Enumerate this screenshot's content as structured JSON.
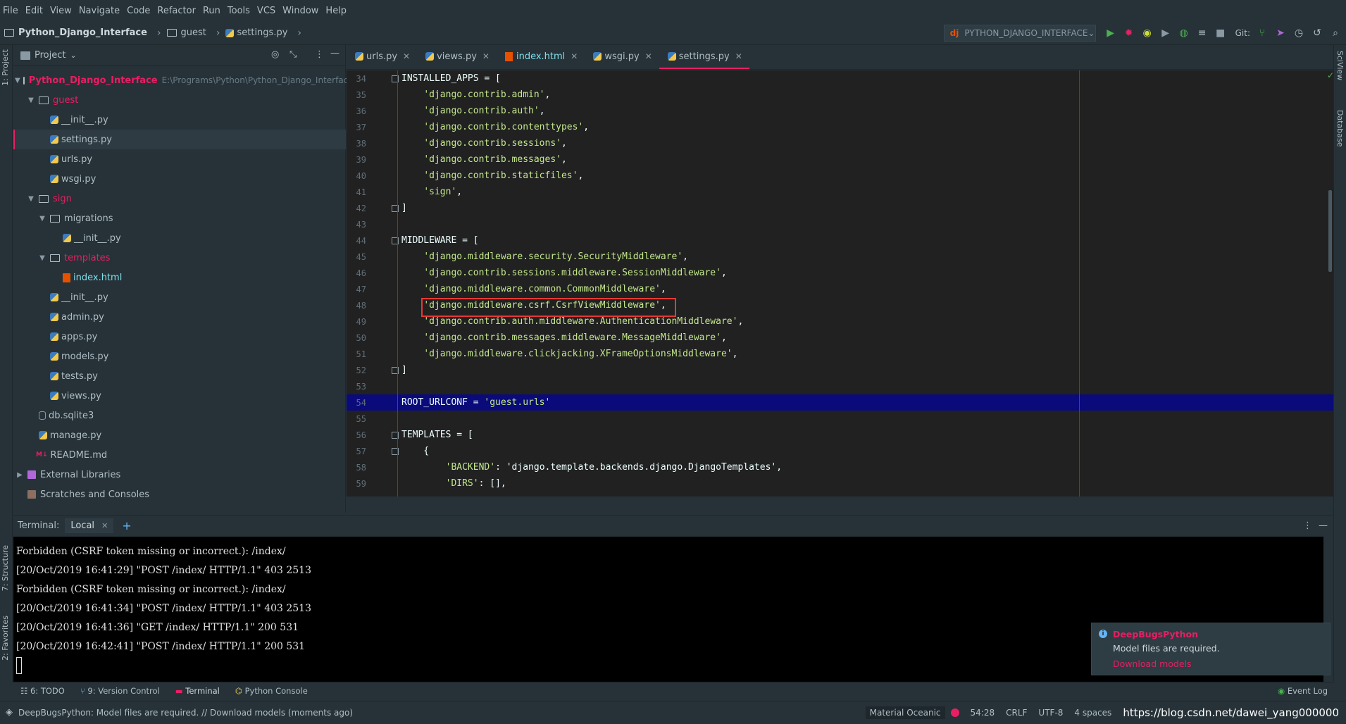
{
  "menu": [
    "File",
    "Edit",
    "View",
    "Navigate",
    "Code",
    "Refactor",
    "Run",
    "Tools",
    "VCS",
    "Window",
    "Help"
  ],
  "breadcrumb": {
    "project": "Python_Django_Interface",
    "folder": "guest",
    "file": "settings.py"
  },
  "run_config": {
    "label": "PYTHON_DJANGO_INTERFACE",
    "git_label": "Git:"
  },
  "project_panel": {
    "title": "Project",
    "tree": [
      {
        "label": "Python_Django_Interface",
        "path": "E:\\Programs\\Python\\Python_Django_Interface"
      },
      {
        "label": "guest"
      },
      {
        "label": "__init__.py"
      },
      {
        "label": "settings.py"
      },
      {
        "label": "urls.py"
      },
      {
        "label": "wsgi.py"
      },
      {
        "label": "sign"
      },
      {
        "label": "migrations"
      },
      {
        "label": "__init__.py"
      },
      {
        "label": "templates"
      },
      {
        "label": "index.html"
      },
      {
        "label": "__init__.py"
      },
      {
        "label": "admin.py"
      },
      {
        "label": "apps.py"
      },
      {
        "label": "models.py"
      },
      {
        "label": "tests.py"
      },
      {
        "label": "views.py"
      },
      {
        "label": "db.sqlite3"
      },
      {
        "label": "manage.py"
      },
      {
        "label": "README.md"
      },
      {
        "label": "External Libraries"
      },
      {
        "label": "Scratches and Consoles"
      }
    ]
  },
  "left_strip": {
    "project": "1: Project",
    "structure": "7: Structure",
    "favorites": "2: Favorites"
  },
  "right_strip": {
    "sciview": "SciView",
    "database": "Database"
  },
  "editor_tabs": [
    {
      "label": "urls.py"
    },
    {
      "label": "views.py"
    },
    {
      "label": "index.html"
    },
    {
      "label": "wsgi.py"
    },
    {
      "label": "settings.py"
    }
  ],
  "code_lines": [
    {
      "n": "34",
      "pre": "INSTALLED_APPS = [",
      "s": "",
      "post": ""
    },
    {
      "n": "35",
      "pre": "    ",
      "s": "'django.contrib.admin'",
      "post": ","
    },
    {
      "n": "36",
      "pre": "    ",
      "s": "'django.contrib.auth'",
      "post": ","
    },
    {
      "n": "37",
      "pre": "    ",
      "s": "'django.contrib.contenttypes'",
      "post": ","
    },
    {
      "n": "38",
      "pre": "    ",
      "s": "'django.contrib.sessions'",
      "post": ","
    },
    {
      "n": "39",
      "pre": "    ",
      "s": "'django.contrib.messages'",
      "post": ","
    },
    {
      "n": "40",
      "pre": "    ",
      "s": "'django.contrib.staticfiles'",
      "post": ","
    },
    {
      "n": "41",
      "pre": "    ",
      "s": "'sign'",
      "post": ","
    },
    {
      "n": "42",
      "pre": "]",
      "s": "",
      "post": ""
    },
    {
      "n": "43",
      "pre": "",
      "s": "",
      "post": ""
    },
    {
      "n": "44",
      "pre": "MIDDLEWARE = [",
      "s": "",
      "post": ""
    },
    {
      "n": "45",
      "pre": "    ",
      "s": "'django.middleware.security.SecurityMiddleware'",
      "post": ","
    },
    {
      "n": "46",
      "pre": "    ",
      "s": "'django.contrib.sessions.middleware.SessionMiddleware'",
      "post": ","
    },
    {
      "n": "47",
      "pre": "    ",
      "s": "'django.middleware.common.CommonMiddleware'",
      "post": ","
    },
    {
      "n": "48",
      "pre": "    ",
      "s": "'django.middleware.csrf.CsrfViewMiddleware'",
      "post": ","
    },
    {
      "n": "49",
      "pre": "    ",
      "s": "'django.contrib.auth.middleware.AuthenticationMiddleware'",
      "post": ","
    },
    {
      "n": "50",
      "pre": "    ",
      "s": "'django.contrib.messages.middleware.MessageMiddleware'",
      "post": ","
    },
    {
      "n": "51",
      "pre": "    ",
      "s": "'django.middleware.clickjacking.XFrameOptionsMiddleware'",
      "post": ","
    },
    {
      "n": "52",
      "pre": "]",
      "s": "",
      "post": ""
    },
    {
      "n": "53",
      "pre": "",
      "s": "",
      "post": ""
    },
    {
      "n": "54",
      "pre": "ROOT_URLCONF = ",
      "s": "'guest.urls'",
      "post": ""
    },
    {
      "n": "55",
      "pre": "",
      "s": "",
      "post": ""
    },
    {
      "n": "56",
      "pre": "TEMPLATES = [",
      "s": "",
      "post": ""
    },
    {
      "n": "57",
      "pre": "    {",
      "s": "",
      "post": ""
    },
    {
      "n": "58",
      "pre": "        ",
      "s": "'BACKEND'",
      "post": ": 'django.template.backends.django.DjangoTemplates',"
    },
    {
      "n": "59",
      "pre": "        ",
      "s": "'DIRS'",
      "post": ": [],"
    }
  ],
  "terminal": {
    "label": "Terminal:",
    "tab": "Local",
    "lines": [
      "Forbidden (CSRF token missing or incorrect.): /index/",
      "[20/Oct/2019 16:41:29] \"POST /index/ HTTP/1.1\" 403 2513",
      "Forbidden (CSRF token missing or incorrect.): /index/",
      "[20/Oct/2019 16:41:34] \"POST /index/ HTTP/1.1\" 403 2513",
      "[20/Oct/2019 16:41:36] \"GET /index/ HTTP/1.1\" 200 531",
      "[20/Oct/2019 16:42:41] \"POST /index/ HTTP/1.1\" 200 531"
    ]
  },
  "bottom_tabs": [
    "6: TODO",
    "9: Version Control",
    "Terminal",
    "Python Console"
  ],
  "event_log": "Event Log",
  "notification": {
    "title": "DeepBugsPython",
    "message": "Model files are required.",
    "link": "Download models"
  },
  "status": {
    "message": "DeepBugsPython: Model files are required. // Download models (moments ago)",
    "theme": "Material Oceanic",
    "position": "54:28",
    "line_sep": "CRLF",
    "encoding": "UTF-8",
    "indent": "4 spaces",
    "watermark": "https://blog.csdn.net/dawei_yang000000"
  }
}
